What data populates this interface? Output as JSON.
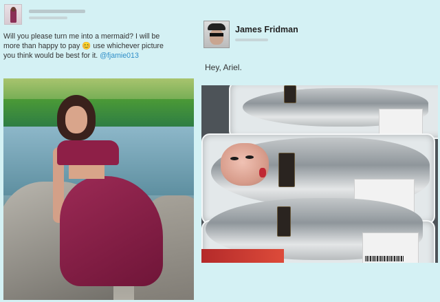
{
  "left_tweet": {
    "text_line1": "Will you please turn me into a mermaid? I will be",
    "text_line2": "more than happy to pay 😊 use whichever picture",
    "text_line3": "you think would be best for it. ",
    "mention": "@fjamie013",
    "image_alt": "woman in magenta lace outfit sitting on rocks by a lake"
  },
  "right_tweet": {
    "author_name": "James Fridman",
    "reply": "Hey, Ariel.",
    "image_alt": "fish on supermarket trays, one with a woman's face edited onto it"
  },
  "colors": {
    "background": "#d4f1f4",
    "link": "#2f8ec8",
    "text": "#333333"
  }
}
